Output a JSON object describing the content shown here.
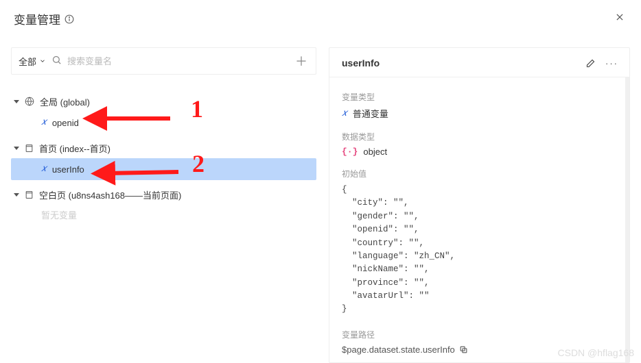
{
  "header": {
    "title": "变量管理",
    "close_label": "×"
  },
  "search": {
    "filter_label": "全部",
    "placeholder": "搜索变量名"
  },
  "tree": {
    "groups": [
      {
        "icon": "globe",
        "label": "全局 (global)",
        "items": [
          {
            "label": "openid",
            "selected": false
          }
        ]
      },
      {
        "icon": "page",
        "label": "首页 (index--首页)",
        "items": [
          {
            "label": "userInfo",
            "selected": true
          }
        ]
      },
      {
        "icon": "page",
        "label": "空白页 (u8ns4ash168——当前页面)",
        "empty": "暂无变量"
      }
    ]
  },
  "detail": {
    "title": "userInfo",
    "sections": {
      "type_label": "变量类型",
      "type_value": "普通变量",
      "datatype_label": "数据类型",
      "datatype_value": "object",
      "init_label": "初始值",
      "init_value": "{\n  \"city\": \"\",\n  \"gender\": \"\",\n  \"openid\": \"\",\n  \"country\": \"\",\n  \"language\": \"zh_CN\",\n  \"nickName\": \"\",\n  \"province\": \"\",\n  \"avatarUrl\": \"\"\n}",
      "path_label": "变量路径",
      "path_value": "$page.dataset.state.userInfo"
    }
  },
  "annotations": {
    "num1": "1",
    "num2": "2"
  },
  "watermark": "CSDN @hflag168"
}
